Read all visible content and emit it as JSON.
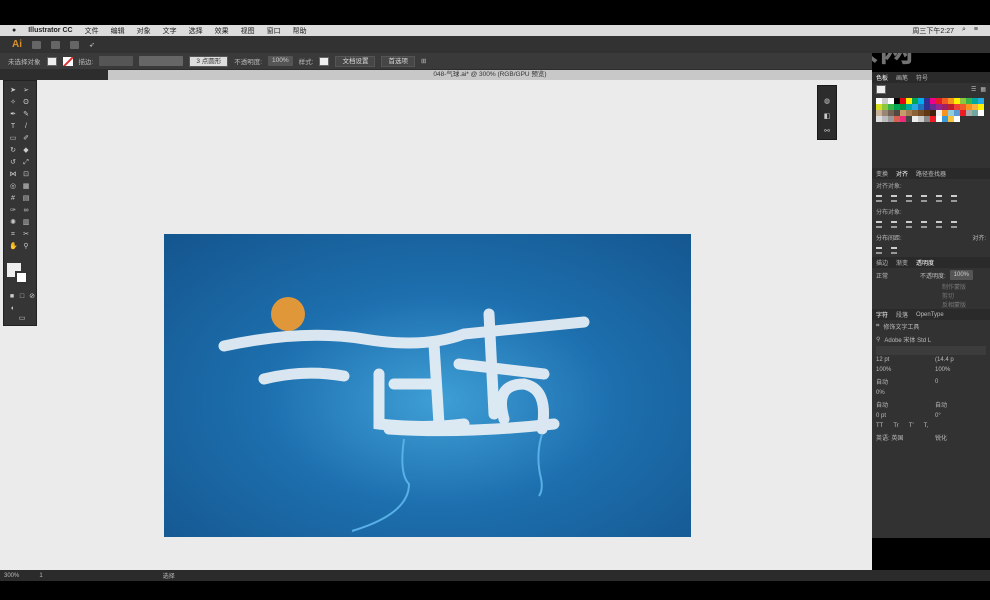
{
  "menubar": {
    "app": "Illustrator CC",
    "items": [
      "文件",
      "编辑",
      "对象",
      "文字",
      "选择",
      "效果",
      "视图",
      "窗口",
      "帮助"
    ],
    "clock": "周三下午2:27"
  },
  "appbar": {
    "logo": "Ai"
  },
  "control": {
    "selection": "未选择对象",
    "stroke_label": "描边:",
    "brush": "3 点圆形",
    "opacity_label": "不透明度:",
    "opacity": "100%",
    "style_label": "样式:",
    "doc_setup": "文档设置",
    "prefs": "首选项"
  },
  "doc": {
    "tab": "048-气球.ai* @ 300% (RGB/GPU 预览)"
  },
  "panels": {
    "swatch_tabs": [
      "色板",
      "画笔",
      "符号"
    ],
    "swatch_colors": [
      "#ffffff",
      "#cccccc",
      "#ffffff",
      "#000000",
      "#e30613",
      "#ffed00",
      "#00a651",
      "#00aeef",
      "#2e3192",
      "#ec008c",
      "#e31e24",
      "#f15a22",
      "#f7941d",
      "#fff200",
      "#8dc63f",
      "#39b54a",
      "#00a99d",
      "#27aae1",
      "#d7df23",
      "#8dc63f",
      "#39b54a",
      "#00a651",
      "#009444",
      "#00a99d",
      "#27aae1",
      "#1c75bc",
      "#2e3192",
      "#662d91",
      "#92278f",
      "#9e1f63",
      "#be1e2d",
      "#ef4136",
      "#f15a29",
      "#f7941d",
      "#fbb040",
      "#fff200",
      "#c7b299",
      "#998675",
      "#736357",
      "#534741",
      "#c69c6d",
      "#a67c52",
      "#8c6239",
      "#754c24",
      "#603813",
      "#42210b",
      "#eeeeee",
      "#f7941d",
      "#93cddd",
      "#5b9bd5",
      "#ed1c24",
      "#aaaaaa",
      "#70a8a0",
      "#ffffff",
      "#dddddd",
      "#bbbbbb",
      "#999999",
      "#d6604d",
      "#ee2a7b",
      "#444444",
      "#eeeeee",
      "#cccccc",
      "#888888",
      "#ed1c24",
      "#ffffff",
      "#3a9ad9",
      "#f5c242",
      "#ffffff"
    ],
    "align_tabs": [
      "变换",
      "对齐",
      "路径查找器"
    ],
    "align_objects": "对齐对象:",
    "distribute_objects": "分布对象:",
    "distribute_spacing": "分布间距:",
    "align_to": "对齐:",
    "transparency_tabs": [
      "描边",
      "渐变",
      "透明度"
    ],
    "blend_mode": "正常",
    "opacity_label": "不透明度:",
    "opacity": "100%",
    "make_mask": "制作蒙版",
    "clip": "剪切",
    "invert_mask": "反相蒙版",
    "char_tabs": [
      "字符",
      "段落",
      "OpenType"
    ],
    "touch_type": "修饰文字工具",
    "font": "Adobe 宋体 Std L",
    "font_size": "12 pt",
    "leading": "(14.4 p",
    "vscale": "100%",
    "hscale": "100%",
    "kerning": "自动",
    "tracking": "0",
    "tsume": "0%",
    "aki_left": "自动",
    "aki_right": "自动",
    "baseline": "0 pt",
    "rotation": "0°",
    "language": "英语: 英国",
    "aa": "锐化"
  },
  "status": {
    "zoom": "300%",
    "page": "1",
    "tool": "选择"
  },
  "watermark": "虎课网"
}
